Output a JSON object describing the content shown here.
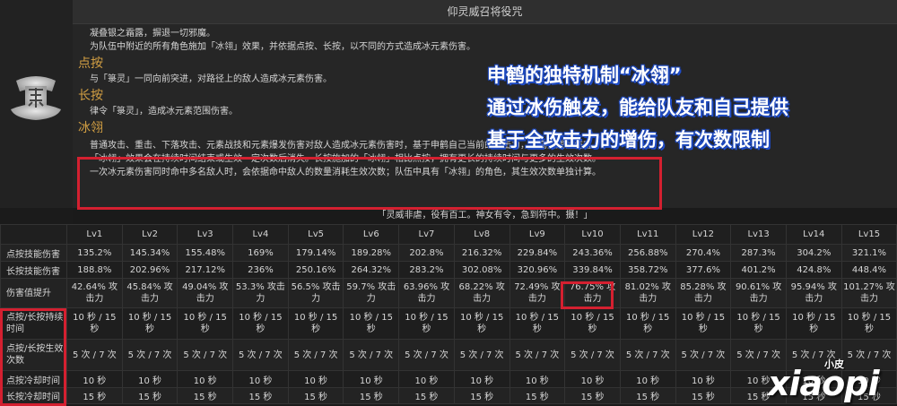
{
  "title": "仰灵威召将役咒",
  "desc": {
    "line1": "凝叠银之霜露，摒退一切邪魔。",
    "line2": "为队伍中附近的所有角色施加「冰翎」效果，并依据点按、长按，以不同的方式造成冰元素伤害。",
    "tap_heading": "点按",
    "tap_text": "与「箓灵」一同向前突进，对路径上的敌人造成冰元素伤害。",
    "hold_heading": "长按",
    "hold_text": "律令「箓灵」，造成冰元素范围伤害。",
    "ice_heading": "冰翎",
    "ice_line1": "普通攻击、重击、下落攻击、元素战技和元素爆发伤害对敌人造成冰元素伤害时，基于申鹤自己当前的攻击力，提高造成的伤害。",
    "ice_line2": "「冰翎」效果会在持续时间结束或生效一定次数后消失。长按施加的「冰翎」相比点按，拥有更长的持续时间与更多的生效次数。",
    "ice_line3": "一次冰元素伤害同时命中多名敌人时，会依据命中敌人的数量消耗生效次数；队伍中具有「冰翎」的角色，其生效次数单独计算。"
  },
  "overlay": {
    "line1": "申鹤的独特机制“冰翎”",
    "line2": "通过冰伤触发，能给队友和自己提供",
    "line3": "基于全攻击力的增伤，有次数限制"
  },
  "quote": "「灵威非虐，役有百工。神女有令，急到符中。摄！」",
  "table": {
    "levels": [
      "Lv1",
      "Lv2",
      "Lv3",
      "Lv4",
      "Lv5",
      "Lv6",
      "Lv7",
      "Lv8",
      "Lv9",
      "Lv10",
      "Lv11",
      "Lv12",
      "Lv13",
      "Lv14",
      "Lv15"
    ],
    "rows": [
      {
        "label": "点按技能伤害",
        "values": [
          "135.2%",
          "145.34%",
          "155.48%",
          "169%",
          "179.14%",
          "189.28%",
          "202.8%",
          "216.32%",
          "229.84%",
          "243.36%",
          "256.88%",
          "270.4%",
          "287.3%",
          "304.2%",
          "321.1%"
        ]
      },
      {
        "label": "长按技能伤害",
        "values": [
          "188.8%",
          "202.96%",
          "217.12%",
          "236%",
          "250.16%",
          "264.32%",
          "283.2%",
          "302.08%",
          "320.96%",
          "339.84%",
          "358.72%",
          "377.6%",
          "401.2%",
          "424.8%",
          "448.4%"
        ]
      },
      {
        "label": "伤害值提升",
        "values": [
          "42.64% 攻击力",
          "45.84% 攻击力",
          "49.04% 攻击力",
          "53.3% 攻击力",
          "56.5% 攻击力",
          "59.7% 攻击力",
          "63.96% 攻击力",
          "68.22% 攻击力",
          "72.49% 攻击力",
          "76.75% 攻击力",
          "81.02% 攻击力",
          "85.28% 攻击力",
          "90.61% 攻击力",
          "95.94% 攻击力",
          "101.27% 攻击力"
        ]
      },
      {
        "label": "点按/长按持续时间",
        "values": [
          "10 秒 / 15 秒",
          "10 秒 / 15 秒",
          "10 秒 / 15 秒",
          "10 秒 / 15 秒",
          "10 秒 / 15 秒",
          "10 秒 / 15 秒",
          "10 秒 / 15 秒",
          "10 秒 / 15 秒",
          "10 秒 / 15 秒",
          "10 秒 / 15 秒",
          "10 秒 / 15 秒",
          "10 秒 / 15 秒",
          "10 秒 / 15 秒",
          "10 秒 / 15 秒",
          "10 秒 / 15 秒"
        ]
      },
      {
        "label": "点按/长按生效次数",
        "values": [
          "5 次 / 7 次",
          "5 次 / 7 次",
          "5 次 / 7 次",
          "5 次 / 7 次",
          "5 次 / 7 次",
          "5 次 / 7 次",
          "5 次 / 7 次",
          "5 次 / 7 次",
          "5 次 / 7 次",
          "5 次 / 7 次",
          "5 次 / 7 次",
          "5 次 / 7 次",
          "5 次 / 7 次",
          "5 次 / 7 次",
          "5 次 / 7 次"
        ]
      },
      {
        "label": "点按冷却时间",
        "values": [
          "10 秒",
          "10 秒",
          "10 秒",
          "10 秒",
          "10 秒",
          "10 秒",
          "10 秒",
          "10 秒",
          "10 秒",
          "10 秒",
          "10 秒",
          "10 秒",
          "10 秒",
          "10 秒",
          "10 秒"
        ]
      },
      {
        "label": "长按冷却时间",
        "values": [
          "15 秒",
          "15 秒",
          "15 秒",
          "15 秒",
          "15 秒",
          "15 秒",
          "15 秒",
          "15 秒",
          "15 秒",
          "15 秒",
          "15 秒",
          "15 秒",
          "15 秒",
          "15 秒",
          "15 秒"
        ]
      }
    ]
  },
  "watermark": {
    "small": "小皮",
    "big": "xiaopi"
  },
  "colors": {
    "highlight_box": "#d42030",
    "section_heading": "#d19e43",
    "overlay_text_outline": "#1f4fd1"
  }
}
